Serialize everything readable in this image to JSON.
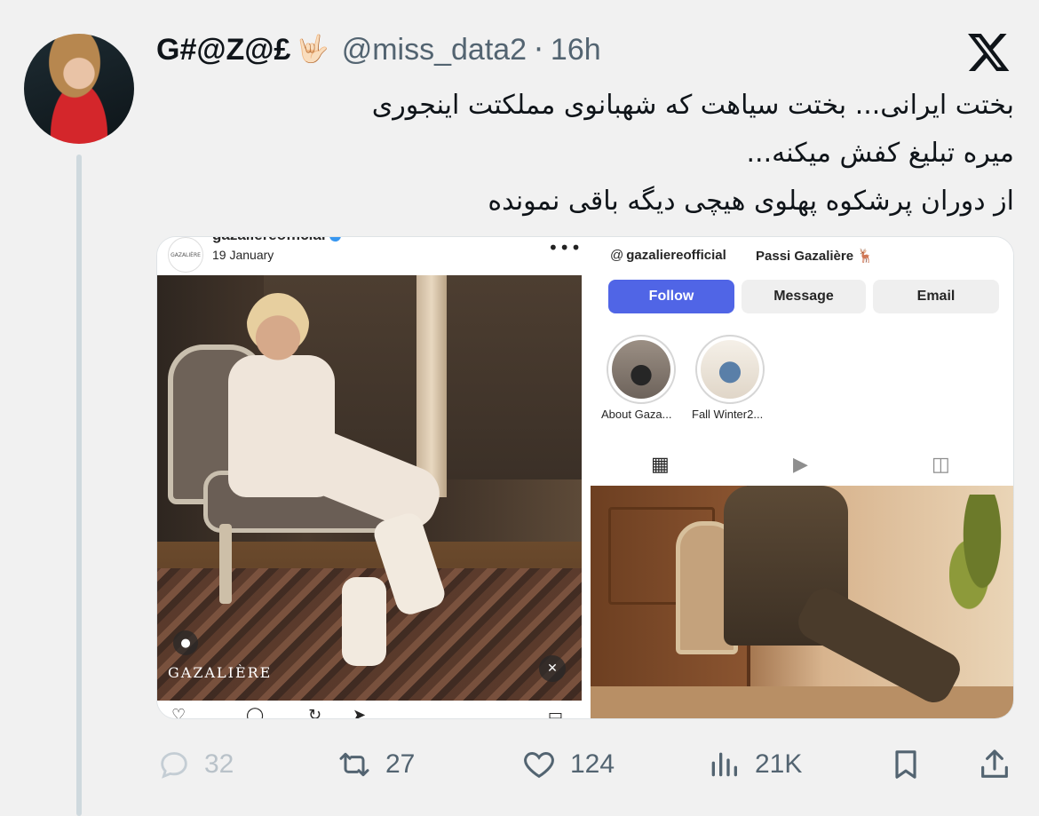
{
  "tweet": {
    "display_name": "G#@Z@£",
    "handle": "@miss_data2",
    "separator": "·",
    "time": "16h",
    "text_lines": [
      "بختت ایرانی... بختت سیاهت که شهبانوی مملکتت اینجوری",
      "میره تبلیغ کفش میکنه...",
      "از دوران پرشکوه پهلوی هیچی دیگه باقی نمونده"
    ]
  },
  "icons": {
    "hand": "🤟🏻",
    "x_logo": "x-logo-icon",
    "reply": "reply-icon",
    "retweet": "retweet-icon",
    "like": "heart-icon",
    "views": "views-icon",
    "bookmark": "bookmark-icon",
    "share": "share-icon"
  },
  "embedded": {
    "post": {
      "username": "gazaliereofficial",
      "date": "19 January",
      "more": "•••",
      "brand_logo_text": "GAZALIÈRE"
    },
    "profile": {
      "threads_handle": "gazaliereofficial",
      "name": "Passi Gazalière 🦌",
      "follow_label": "Follow",
      "message_label": "Message",
      "email_label": "Email",
      "highlights": [
        {
          "label": "About Gaza..."
        },
        {
          "label": "Fall Winter2..."
        }
      ]
    }
  },
  "actions": {
    "replies": "32",
    "retweets": "27",
    "likes": "124",
    "views": "21K"
  },
  "colors": {
    "background": "#f1f1f1",
    "text_primary": "#0f1419",
    "text_secondary": "#536471",
    "follow_button": "#5065e6"
  }
}
